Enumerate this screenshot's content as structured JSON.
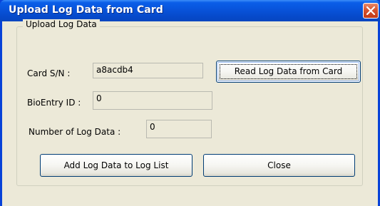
{
  "window": {
    "title": "Upload Log Data from Card"
  },
  "group": {
    "legend": "Upload Log Data"
  },
  "fields": {
    "card_sn_label": "Card S/N :",
    "card_sn_value": "a8acdb4",
    "bioentry_label": "BioEntry ID :",
    "bioentry_value": "0",
    "num_log_label": "Number of Log Data :",
    "num_log_value": "0"
  },
  "buttons": {
    "read_log": "Read Log Data from Card",
    "add_log": "Add Log Data to Log List",
    "close": "Close"
  },
  "icons": {
    "title_close": "close-x-icon"
  },
  "colors": {
    "titlebar": "#0855dd",
    "face": "#ece9d8",
    "close_button": "#d6532f"
  }
}
